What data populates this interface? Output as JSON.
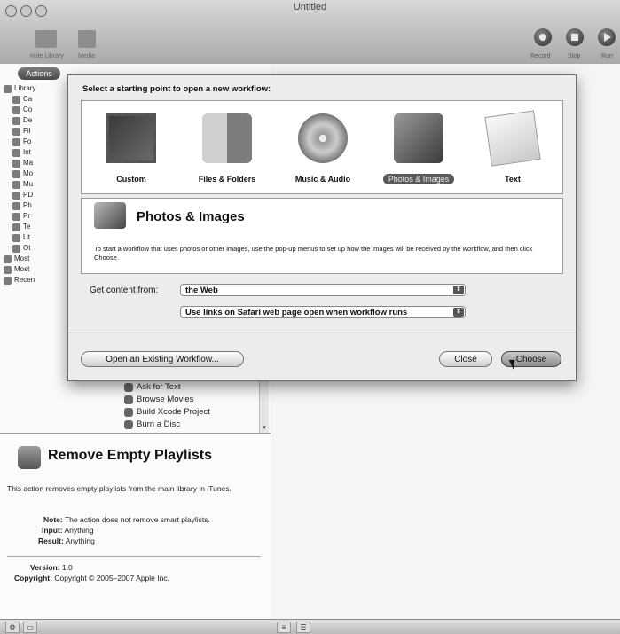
{
  "window": {
    "title": "Untitled"
  },
  "toolbar": {
    "hide_library": "Hide Library",
    "media": "Media",
    "record": "Record",
    "stop": "Stop",
    "run": "Run"
  },
  "left": {
    "actions_tab": "Actions",
    "library_items": [
      "Library",
      "Ca",
      "Co",
      "De",
      "Fil",
      "Fo",
      "Int",
      "Ma",
      "Mo",
      "Mu",
      "PD",
      "Ph",
      "Pr",
      "Te",
      "Ut",
      "Ot",
      "Most",
      "Most",
      "Recen"
    ],
    "action_items": [
      "Ask for Text",
      "Browse Movies",
      "Build Xcode Project",
      "Burn a Disc"
    ]
  },
  "description": {
    "title": "Remove Empty Playlists",
    "text": "This action removes empty playlists from the main library in iTunes.",
    "note_label": "Note:",
    "note_value": "The action does not remove smart playlists.",
    "input_label": "Input:",
    "input_value": "Anything",
    "result_label": "Result:",
    "result_value": "Anything",
    "version_label": "Version:",
    "version_value": "1.0",
    "copyright_label": "Copyright:",
    "copyright_value": "Copyright © 2005–2007 Apple Inc."
  },
  "sheet": {
    "prompt": "Select a starting point to open a new workflow:",
    "categories": [
      {
        "label": "Custom",
        "icon": "custom-icon"
      },
      {
        "label": "Files & Folders",
        "icon": "finder-icon"
      },
      {
        "label": "Music & Audio",
        "icon": "music-icon"
      },
      {
        "label": "Photos & Images",
        "icon": "photos-icon",
        "selected": true
      },
      {
        "label": "Text",
        "icon": "text-icon"
      }
    ],
    "selected_title": "Photos & Images",
    "selected_description": "To start a workflow that uses photos or other images, use the pop-up menus to set up how the images will be received by the workflow, and then click Choose.",
    "get_content_label": "Get content from:",
    "get_content_value": "the Web",
    "links_value": "Use links on Safari web page open when workflow runs",
    "open_existing": "Open an Existing Workflow...",
    "close": "Close",
    "choose": "Choose"
  }
}
